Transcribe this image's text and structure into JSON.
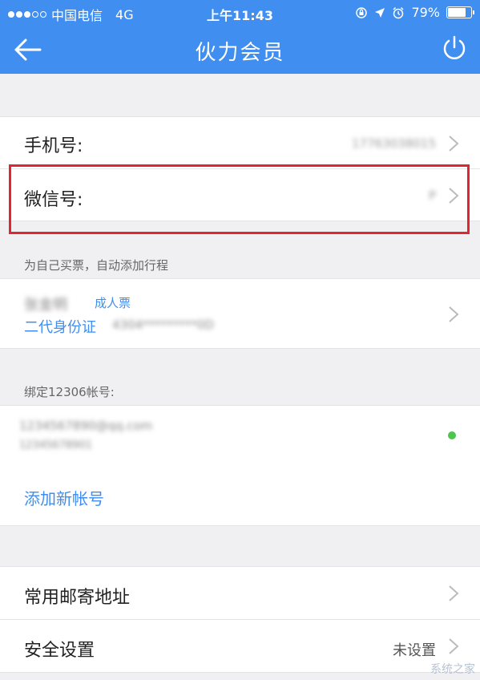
{
  "status_bar": {
    "carrier": "中国电信",
    "network": "4G",
    "time": "上午11:43",
    "battery_pct": "79%",
    "battery_level": 0.79
  },
  "nav": {
    "title": "伙力会员",
    "back_icon": "back-arrow-icon",
    "power_icon": "power-icon"
  },
  "account": {
    "phone_label": "手机号:",
    "phone_value": "17763038015",
    "wechat_label": "微信号:",
    "wechat_value": "P"
  },
  "passenger": {
    "section_title": "为自己买票，自动添加行程",
    "name": "张金明",
    "ticket_type": "成人票",
    "id_type": "二代身份证",
    "id_number": "4304*********0D"
  },
  "railway": {
    "section_title": "绑定12306帐号:",
    "account_email": "1234567890@qq.com",
    "account_sub": "12345678901",
    "add_label": "添加新帐号"
  },
  "settings": {
    "address_label": "常用邮寄地址",
    "security_label": "安全设置",
    "security_value": "未设置"
  },
  "watermark": "系统之家",
  "colors": {
    "brand": "#3f8ef0",
    "highlight": "#e0262e",
    "status_green": "#4cc64e"
  }
}
